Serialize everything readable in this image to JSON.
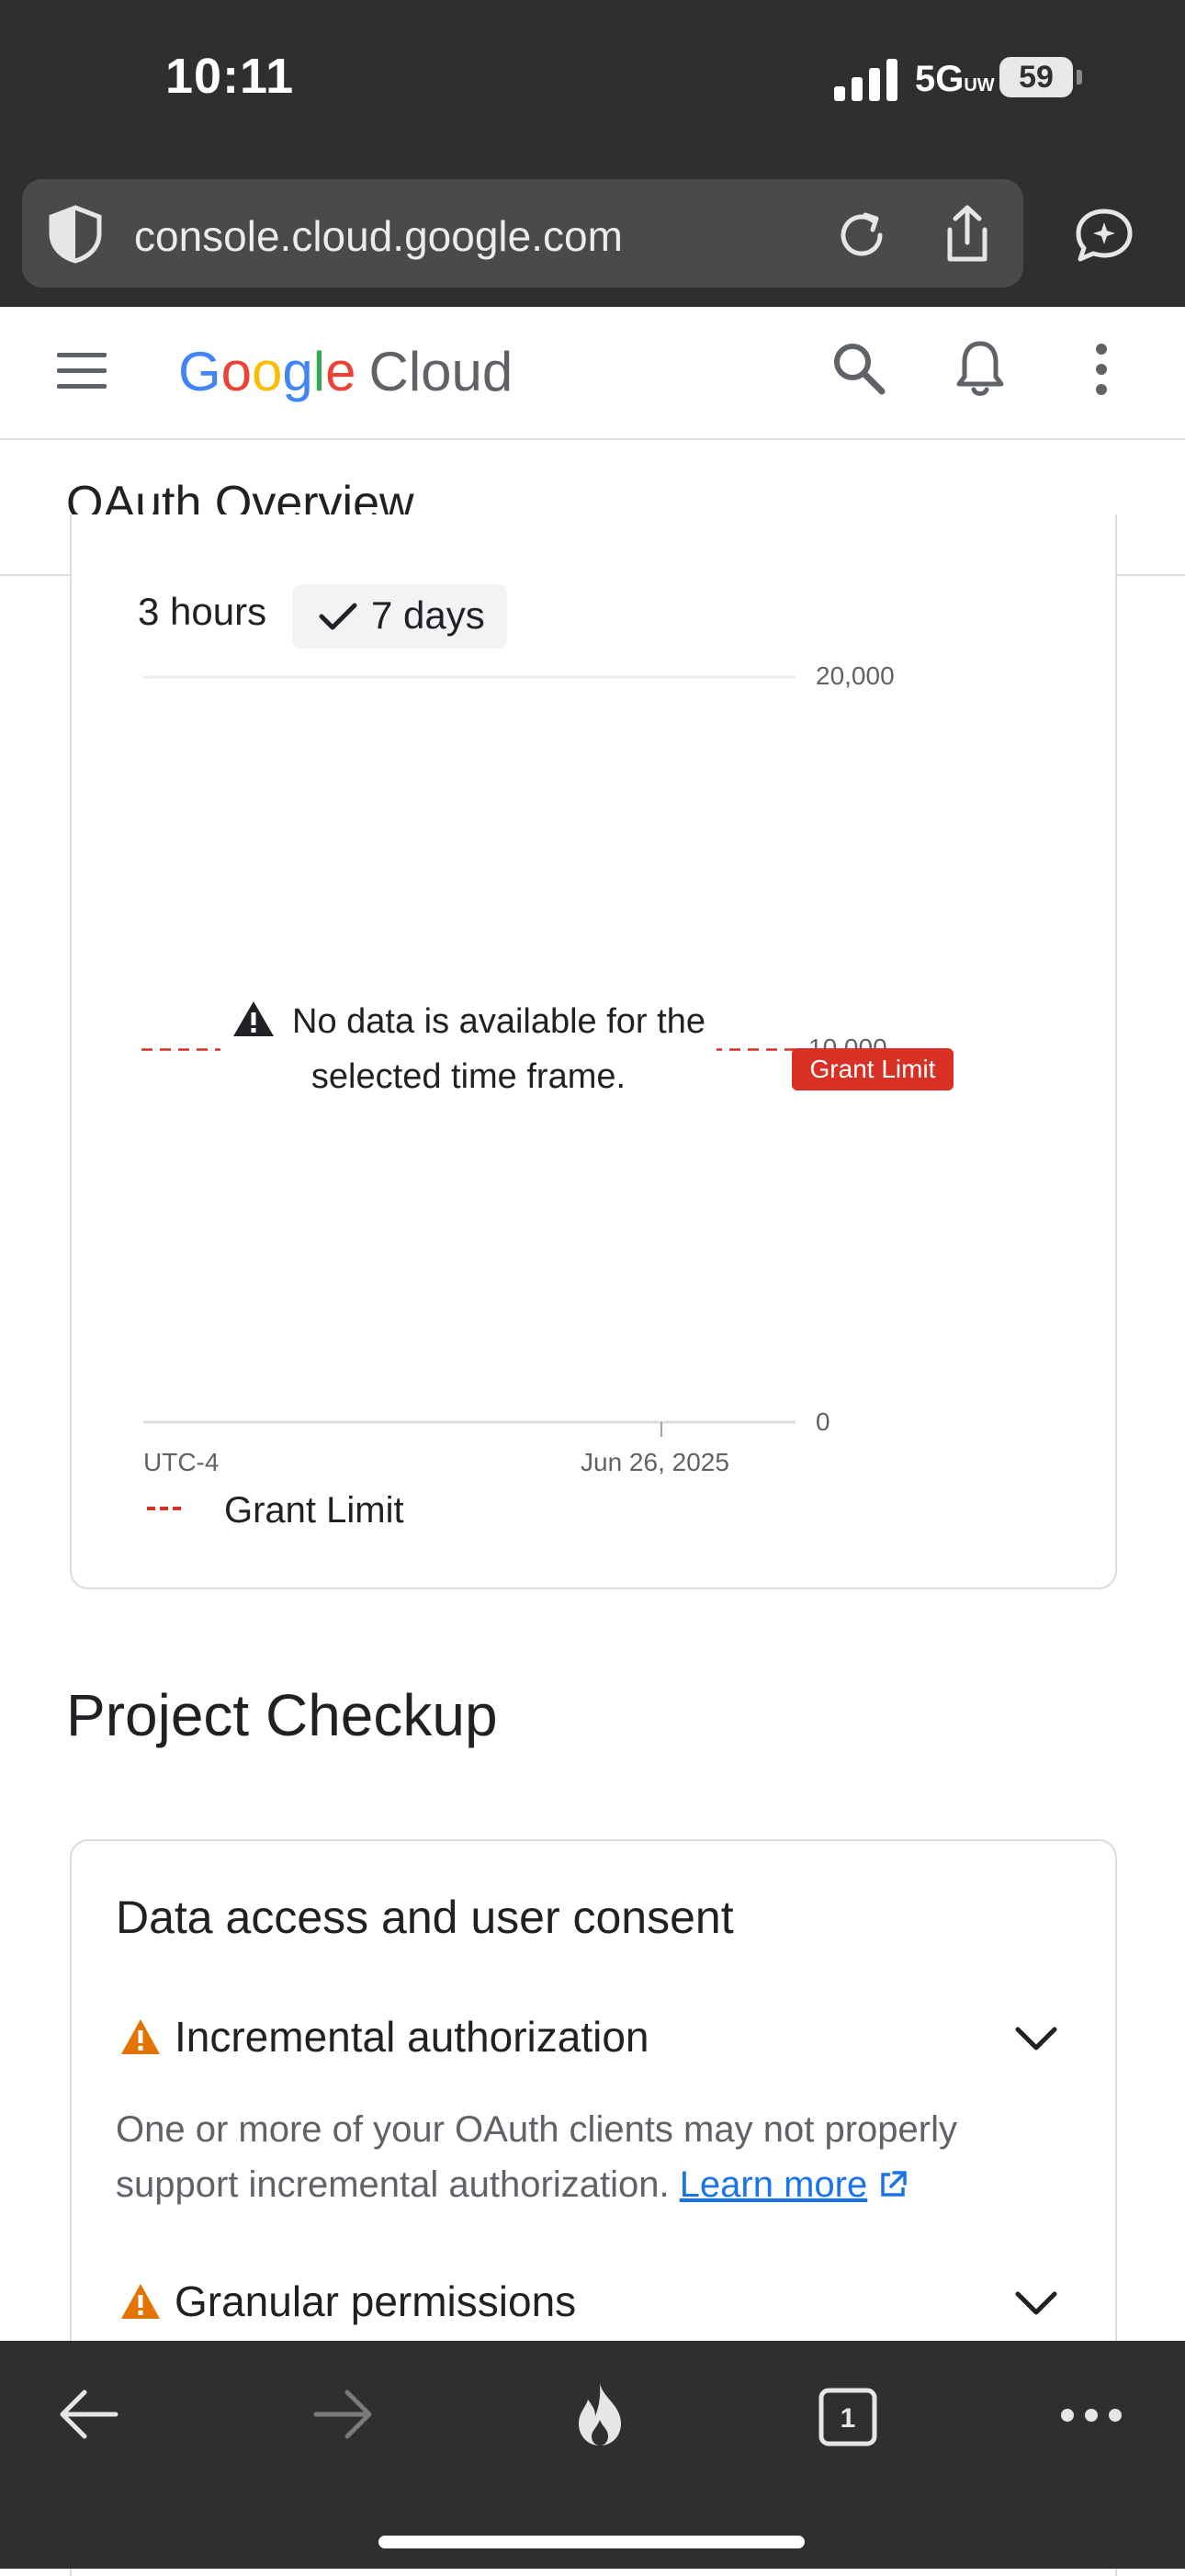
{
  "status_bar": {
    "time": "10:11",
    "network": "5G",
    "network_sub": "UW",
    "battery": "59"
  },
  "browser": {
    "url": "console.cloud.google.com"
  },
  "header": {
    "logo_letters": [
      "G",
      "o",
      "o",
      "g",
      "l",
      "e"
    ],
    "logo_product": "Cloud"
  },
  "page": {
    "title": "OAuth Overview"
  },
  "time_range": {
    "options": [
      "3 hours",
      "7 days"
    ],
    "selected": "7 days"
  },
  "chart_data": {
    "type": "line",
    "y_ticks": [
      "20,000",
      "10,000",
      "0"
    ],
    "ylim": [
      0,
      20000
    ],
    "x_ticks": [
      "Jun 26, 2025"
    ],
    "timezone": "UTC-4",
    "series": [
      {
        "name": "Grant Limit",
        "values": [
          10000
        ],
        "style": "dashed",
        "color": "#d93025"
      }
    ],
    "no_data_message": "No data is available for the selected time frame.",
    "legend": [
      {
        "name": "Grant Limit",
        "color": "#d93025"
      }
    ]
  },
  "project_checkup": {
    "title": "Project Checkup",
    "card_title": "Data access and user consent",
    "items": [
      {
        "title": "Incremental authorization",
        "description": "One or more of your OAuth clients may not properly support incremental authorization.",
        "link": "Learn more"
      },
      {
        "title": "Granular permissions"
      }
    ]
  },
  "colors": {
    "brand_blue": "#1a73e8",
    "warning": "#e37400",
    "limit_red": "#d93025",
    "chrome_dark": "#2f2f2f"
  }
}
